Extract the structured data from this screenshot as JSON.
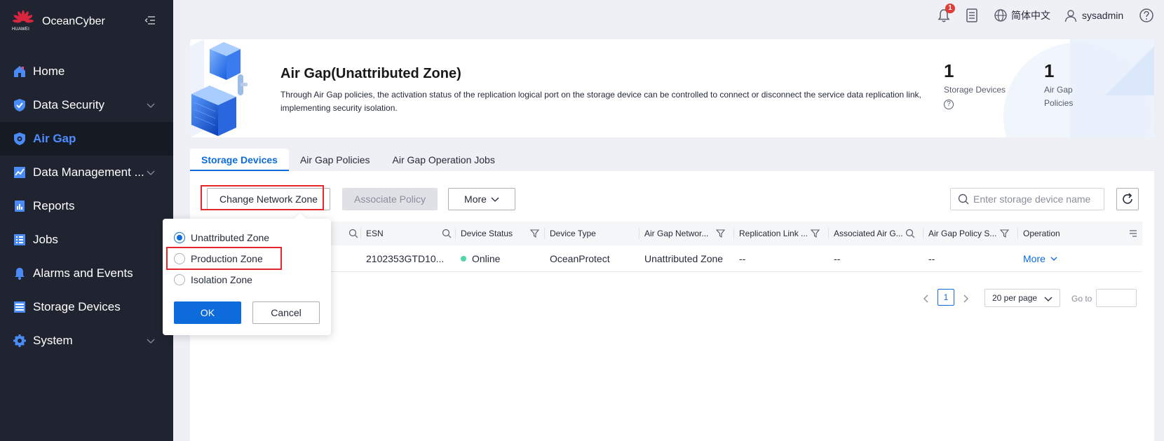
{
  "app": {
    "name": "OceanCyber",
    "logo_text": "HUAWEI"
  },
  "sidebar": {
    "items": [
      {
        "label": "Home",
        "icon": "home-icon",
        "active": false,
        "expandable": false
      },
      {
        "label": "Data Security",
        "icon": "shield-icon",
        "active": false,
        "expandable": true
      },
      {
        "label": "Air Gap",
        "icon": "air-gap-icon",
        "active": true,
        "expandable": false
      },
      {
        "label": "Data Management ...",
        "icon": "chart-icon",
        "active": false,
        "expandable": true
      },
      {
        "label": "Reports",
        "icon": "report-icon",
        "active": false,
        "expandable": false
      },
      {
        "label": "Jobs",
        "icon": "jobs-icon",
        "active": false,
        "expandable": false
      },
      {
        "label": "Alarms and Events",
        "icon": "bell-icon",
        "active": false,
        "expandable": false
      },
      {
        "label": "Storage Devices",
        "icon": "storage-icon",
        "active": false,
        "expandable": false
      },
      {
        "label": "System",
        "icon": "gear-icon",
        "active": false,
        "expandable": true
      }
    ]
  },
  "topbar": {
    "notification_count": "1",
    "language": "简体中文",
    "user": "sysadmin"
  },
  "banner": {
    "title": "Air Gap(Unattributed Zone)",
    "description": "Through Air Gap policies, the activation status of the replication logical port on the storage device can be controlled to connect or disconnect the service data replication link, implementing security isolation.",
    "stats": [
      {
        "value": "1",
        "label": "Storage Devices"
      },
      {
        "value": "1",
        "label_line1": "Air Gap",
        "label_line2": "Policies"
      }
    ]
  },
  "tabs": [
    {
      "label": "Storage Devices",
      "active": true
    },
    {
      "label": "Air Gap Policies",
      "active": false
    },
    {
      "label": "Air Gap Operation Jobs",
      "active": false
    }
  ],
  "toolbar": {
    "change_zone_label": "Change Network Zone",
    "associate_label": "Associate Policy",
    "more_label": "More",
    "search_placeholder": "Enter storage device name"
  },
  "table": {
    "columns": [
      "ESN",
      "Device Status",
      "Device Type",
      "Air Gap Networ...",
      "Replication Link ...",
      "Associated Air G...",
      "Air Gap Policy S...",
      "Operation"
    ],
    "rows": [
      {
        "esn": "2102353GTD10...",
        "status": "Online",
        "type": "OceanProtect",
        "zone": "Unattributed Zone",
        "replication": "--",
        "associated": "--",
        "policy_status": "--",
        "operation": "More"
      }
    ]
  },
  "pagination": {
    "current_page": "1",
    "per_page": "20 per page",
    "goto_label": "Go to"
  },
  "popover": {
    "options": [
      {
        "label": "Unattributed Zone",
        "checked": true
      },
      {
        "label": "Production Zone",
        "checked": false
      },
      {
        "label": "Isolation Zone",
        "checked": false
      }
    ],
    "ok_label": "OK",
    "cancel_label": "Cancel"
  },
  "colors": {
    "sidebar_bg": "#1f2430",
    "accent": "#0d6bdb",
    "highlight_box": "#e5262a",
    "online": "#50d4ab"
  }
}
